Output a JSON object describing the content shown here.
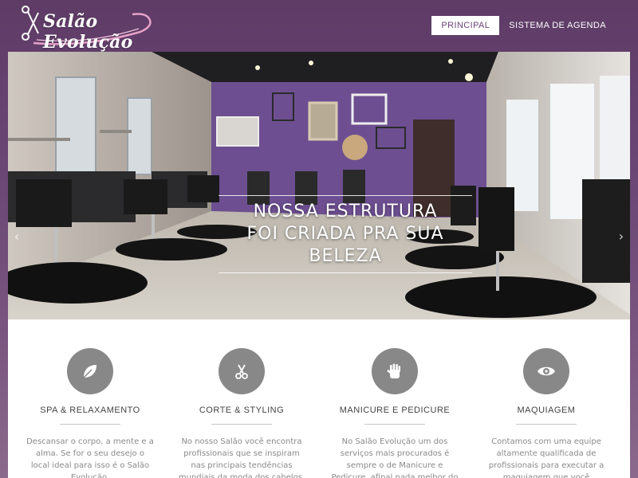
{
  "brand": {
    "name": "Salão Evolução",
    "colors": {
      "primary": "#6b4377",
      "icon_gray": "#888888"
    }
  },
  "nav": {
    "items": [
      {
        "label": "PRINCIPAL",
        "active": true
      },
      {
        "label": "SISTEMA DE AGENDA",
        "active": false
      }
    ]
  },
  "hero": {
    "line1": "NOSSA ESTRUTURA",
    "line2": "FOI CRIADA PRA SUA BELEZA",
    "image": "salon-interior-photo"
  },
  "services": [
    {
      "icon": "leaf-icon",
      "title": "SPA & RELAXAMENTO",
      "description": "Descansar o corpo, a mente e a alma. Se for o seu desejo o local ideal para isso é o Salão Evolução."
    },
    {
      "icon": "scissors-icon",
      "title": "CORTE & STYLING",
      "description": "No nosso Salão você encontra profissionais que se inspiram nas principais tendências mundiais da moda dos cabelos."
    },
    {
      "icon": "hand-icon",
      "title": "MANICURE E PEDICURE",
      "description": "No Salão Evolução um dos serviços mais procurados é sempre o de Manicure e Pedicure, afinal nada melhor do que cuidar das unhas."
    },
    {
      "icon": "eye-icon",
      "title": "MAQUIAGEM",
      "description": "Contamos com uma equipe altamente qualificada de profissionais para executar a maquiagem que você necessita."
    }
  ]
}
